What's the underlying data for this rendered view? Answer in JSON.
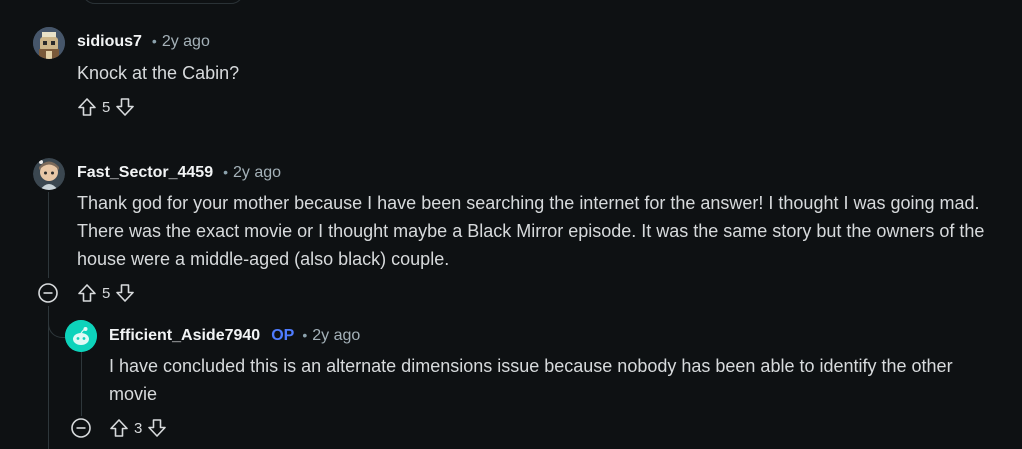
{
  "comments": [
    {
      "username": "sidious7",
      "op": "",
      "time": "2y ago",
      "text": "Knock at the Cabin?",
      "votes": "5",
      "avatar": "cartoon-avatar-icon"
    },
    {
      "username": "Fast_Sector_4459",
      "op": "",
      "time": "2y ago",
      "text": "Thank god for your mother because I have been searching the internet for the answer! I thought I was going mad. There was the exact movie or I thought maybe a Black Mirror episode. It was the same story but the owners of the house were a middle-aged (also black) couple.",
      "votes": "5",
      "avatar": "cartoon-avatar-icon"
    },
    {
      "username": "Efficient_Aside7940",
      "op": "OP",
      "time": "2y ago",
      "text": "I have concluded this is an alternate dimensions issue because nobody has been able to identify the other movie",
      "votes": "3",
      "avatar": "snoo-avatar-icon"
    }
  ],
  "separator": "•",
  "colors": {
    "background": "#0e1113",
    "text": "#d7dadc",
    "meta": "#a4b1b8",
    "op": "#4f7cff",
    "snoo_avatar": "#0dd3bb"
  }
}
